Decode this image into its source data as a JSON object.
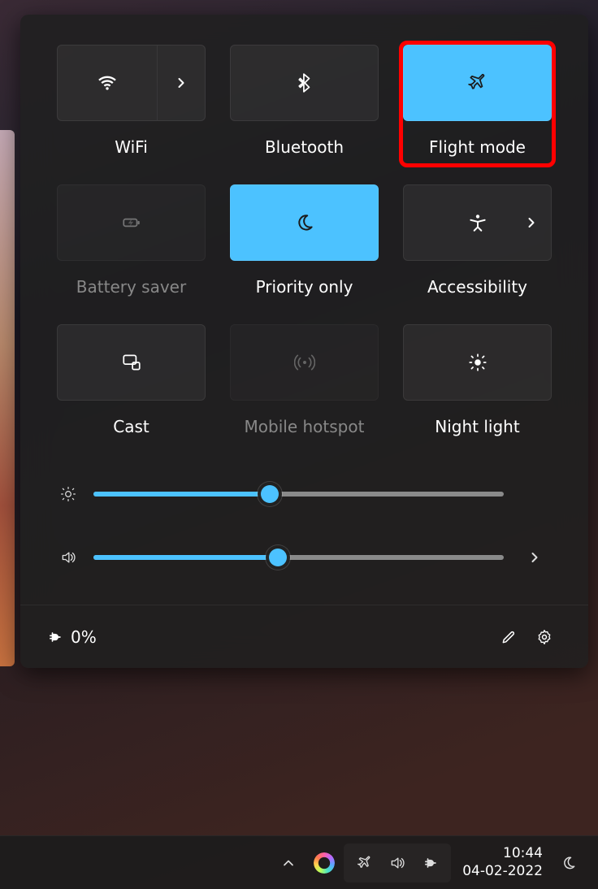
{
  "tiles": [
    {
      "key": "wifi",
      "label": "WiFi",
      "on": false,
      "split": true,
      "dim": false,
      "highlight": false
    },
    {
      "key": "bluetooth",
      "label": "Bluetooth",
      "on": false,
      "split": false,
      "dim": false,
      "highlight": false
    },
    {
      "key": "flight",
      "label": "Flight mode",
      "on": true,
      "split": false,
      "dim": false,
      "highlight": true
    },
    {
      "key": "battery",
      "label": "Battery saver",
      "on": false,
      "split": false,
      "dim": true,
      "highlight": false
    },
    {
      "key": "priority",
      "label": "Priority only",
      "on": true,
      "split": false,
      "dim": false,
      "highlight": false
    },
    {
      "key": "accessibility",
      "label": "Accessibility",
      "on": false,
      "split": false,
      "dim": false,
      "highlight": false,
      "chev": true
    },
    {
      "key": "cast",
      "label": "Cast",
      "on": false,
      "split": false,
      "dim": false,
      "highlight": false
    },
    {
      "key": "hotspot",
      "label": "Mobile hotspot",
      "on": false,
      "split": false,
      "dim": true,
      "highlight": false
    },
    {
      "key": "nightlight",
      "label": "Night light",
      "on": false,
      "split": false,
      "dim": false,
      "highlight": false
    }
  ],
  "sliders": {
    "brightness": {
      "value": 43
    },
    "volume": {
      "value": 45,
      "expandable": true
    }
  },
  "footer": {
    "battery_text": "0%"
  },
  "taskbar": {
    "time": "10:44",
    "date": "04-02-2022"
  },
  "colors": {
    "accent": "#4cc2ff",
    "highlight": "#ff0000"
  }
}
